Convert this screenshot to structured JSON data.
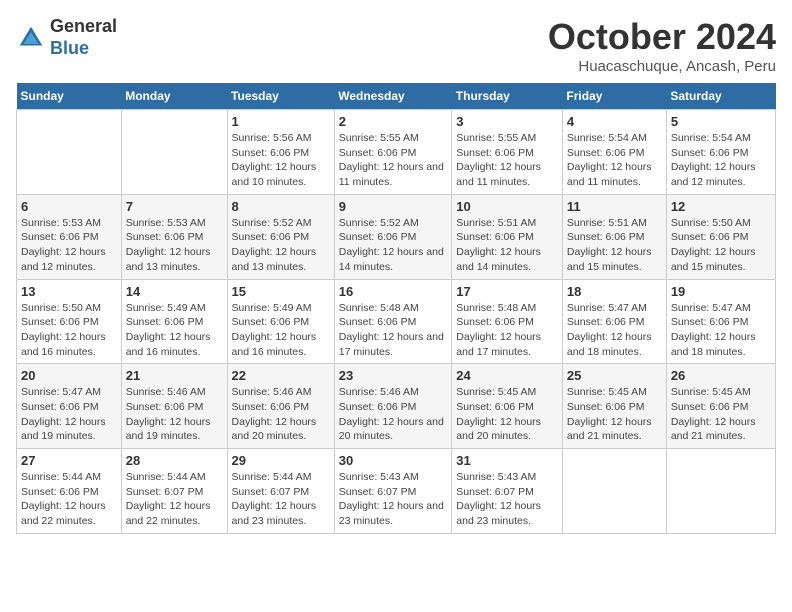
{
  "logo": {
    "general": "General",
    "blue": "Blue"
  },
  "title": "October 2024",
  "subtitle": "Huacaschuque, Ancash, Peru",
  "weekdays": [
    "Sunday",
    "Monday",
    "Tuesday",
    "Wednesday",
    "Thursday",
    "Friday",
    "Saturday"
  ],
  "weeks": [
    [
      {
        "day": "",
        "sunrise": "",
        "sunset": "",
        "daylight": ""
      },
      {
        "day": "",
        "sunrise": "",
        "sunset": "",
        "daylight": ""
      },
      {
        "day": "1",
        "sunrise": "Sunrise: 5:56 AM",
        "sunset": "Sunset: 6:06 PM",
        "daylight": "Daylight: 12 hours and 10 minutes."
      },
      {
        "day": "2",
        "sunrise": "Sunrise: 5:55 AM",
        "sunset": "Sunset: 6:06 PM",
        "daylight": "Daylight: 12 hours and 11 minutes."
      },
      {
        "day": "3",
        "sunrise": "Sunrise: 5:55 AM",
        "sunset": "Sunset: 6:06 PM",
        "daylight": "Daylight: 12 hours and 11 minutes."
      },
      {
        "day": "4",
        "sunrise": "Sunrise: 5:54 AM",
        "sunset": "Sunset: 6:06 PM",
        "daylight": "Daylight: 12 hours and 11 minutes."
      },
      {
        "day": "5",
        "sunrise": "Sunrise: 5:54 AM",
        "sunset": "Sunset: 6:06 PM",
        "daylight": "Daylight: 12 hours and 12 minutes."
      }
    ],
    [
      {
        "day": "6",
        "sunrise": "Sunrise: 5:53 AM",
        "sunset": "Sunset: 6:06 PM",
        "daylight": "Daylight: 12 hours and 12 minutes."
      },
      {
        "day": "7",
        "sunrise": "Sunrise: 5:53 AM",
        "sunset": "Sunset: 6:06 PM",
        "daylight": "Daylight: 12 hours and 13 minutes."
      },
      {
        "day": "8",
        "sunrise": "Sunrise: 5:52 AM",
        "sunset": "Sunset: 6:06 PM",
        "daylight": "Daylight: 12 hours and 13 minutes."
      },
      {
        "day": "9",
        "sunrise": "Sunrise: 5:52 AM",
        "sunset": "Sunset: 6:06 PM",
        "daylight": "Daylight: 12 hours and 14 minutes."
      },
      {
        "day": "10",
        "sunrise": "Sunrise: 5:51 AM",
        "sunset": "Sunset: 6:06 PM",
        "daylight": "Daylight: 12 hours and 14 minutes."
      },
      {
        "day": "11",
        "sunrise": "Sunrise: 5:51 AM",
        "sunset": "Sunset: 6:06 PM",
        "daylight": "Daylight: 12 hours and 15 minutes."
      },
      {
        "day": "12",
        "sunrise": "Sunrise: 5:50 AM",
        "sunset": "Sunset: 6:06 PM",
        "daylight": "Daylight: 12 hours and 15 minutes."
      }
    ],
    [
      {
        "day": "13",
        "sunrise": "Sunrise: 5:50 AM",
        "sunset": "Sunset: 6:06 PM",
        "daylight": "Daylight: 12 hours and 16 minutes."
      },
      {
        "day": "14",
        "sunrise": "Sunrise: 5:49 AM",
        "sunset": "Sunset: 6:06 PM",
        "daylight": "Daylight: 12 hours and 16 minutes."
      },
      {
        "day": "15",
        "sunrise": "Sunrise: 5:49 AM",
        "sunset": "Sunset: 6:06 PM",
        "daylight": "Daylight: 12 hours and 16 minutes."
      },
      {
        "day": "16",
        "sunrise": "Sunrise: 5:48 AM",
        "sunset": "Sunset: 6:06 PM",
        "daylight": "Daylight: 12 hours and 17 minutes."
      },
      {
        "day": "17",
        "sunrise": "Sunrise: 5:48 AM",
        "sunset": "Sunset: 6:06 PM",
        "daylight": "Daylight: 12 hours and 17 minutes."
      },
      {
        "day": "18",
        "sunrise": "Sunrise: 5:47 AM",
        "sunset": "Sunset: 6:06 PM",
        "daylight": "Daylight: 12 hours and 18 minutes."
      },
      {
        "day": "19",
        "sunrise": "Sunrise: 5:47 AM",
        "sunset": "Sunset: 6:06 PM",
        "daylight": "Daylight: 12 hours and 18 minutes."
      }
    ],
    [
      {
        "day": "20",
        "sunrise": "Sunrise: 5:47 AM",
        "sunset": "Sunset: 6:06 PM",
        "daylight": "Daylight: 12 hours and 19 minutes."
      },
      {
        "day": "21",
        "sunrise": "Sunrise: 5:46 AM",
        "sunset": "Sunset: 6:06 PM",
        "daylight": "Daylight: 12 hours and 19 minutes."
      },
      {
        "day": "22",
        "sunrise": "Sunrise: 5:46 AM",
        "sunset": "Sunset: 6:06 PM",
        "daylight": "Daylight: 12 hours and 20 minutes."
      },
      {
        "day": "23",
        "sunrise": "Sunrise: 5:46 AM",
        "sunset": "Sunset: 6:06 PM",
        "daylight": "Daylight: 12 hours and 20 minutes."
      },
      {
        "day": "24",
        "sunrise": "Sunrise: 5:45 AM",
        "sunset": "Sunset: 6:06 PM",
        "daylight": "Daylight: 12 hours and 20 minutes."
      },
      {
        "day": "25",
        "sunrise": "Sunrise: 5:45 AM",
        "sunset": "Sunset: 6:06 PM",
        "daylight": "Daylight: 12 hours and 21 minutes."
      },
      {
        "day": "26",
        "sunrise": "Sunrise: 5:45 AM",
        "sunset": "Sunset: 6:06 PM",
        "daylight": "Daylight: 12 hours and 21 minutes."
      }
    ],
    [
      {
        "day": "27",
        "sunrise": "Sunrise: 5:44 AM",
        "sunset": "Sunset: 6:06 PM",
        "daylight": "Daylight: 12 hours and 22 minutes."
      },
      {
        "day": "28",
        "sunrise": "Sunrise: 5:44 AM",
        "sunset": "Sunset: 6:07 PM",
        "daylight": "Daylight: 12 hours and 22 minutes."
      },
      {
        "day": "29",
        "sunrise": "Sunrise: 5:44 AM",
        "sunset": "Sunset: 6:07 PM",
        "daylight": "Daylight: 12 hours and 23 minutes."
      },
      {
        "day": "30",
        "sunrise": "Sunrise: 5:43 AM",
        "sunset": "Sunset: 6:07 PM",
        "daylight": "Daylight: 12 hours and 23 minutes."
      },
      {
        "day": "31",
        "sunrise": "Sunrise: 5:43 AM",
        "sunset": "Sunset: 6:07 PM",
        "daylight": "Daylight: 12 hours and 23 minutes."
      },
      {
        "day": "",
        "sunrise": "",
        "sunset": "",
        "daylight": ""
      },
      {
        "day": "",
        "sunrise": "",
        "sunset": "",
        "daylight": ""
      }
    ]
  ]
}
